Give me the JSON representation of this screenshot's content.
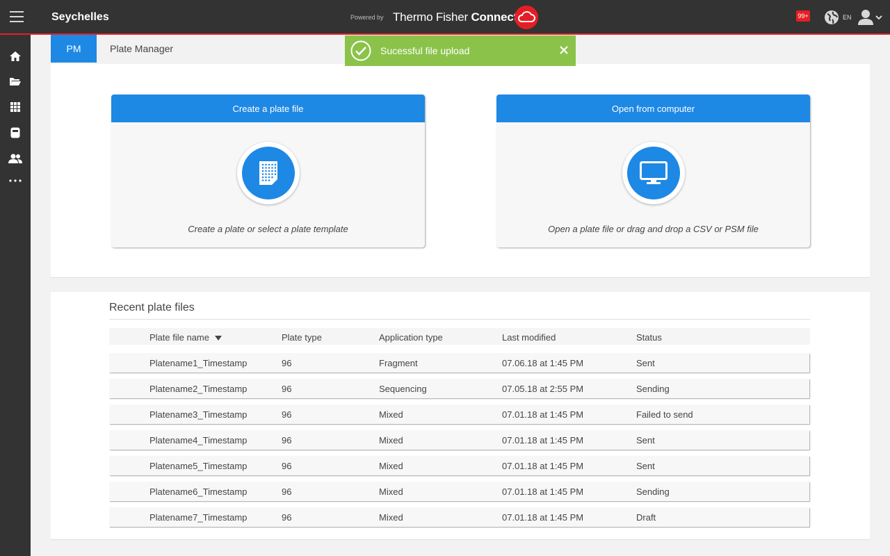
{
  "header": {
    "app_title": "Seychelles",
    "powered_by": "Powered by",
    "brand_light": "Thermo Fisher ",
    "brand_bold": "Connect",
    "notification_count": "99+",
    "language": "EN",
    "bar_color": "#333333",
    "accent_color": "#e51e25"
  },
  "sidebar": {
    "items": [
      {
        "name": "home-icon"
      },
      {
        "name": "folder-icon"
      },
      {
        "name": "apps-grid-icon"
      },
      {
        "name": "storage-icon"
      },
      {
        "name": "users-icon"
      },
      {
        "name": "more-icon"
      }
    ]
  },
  "tabs": {
    "active_badge": "PM",
    "module_label": "Plate Manager"
  },
  "toast": {
    "message": "Sucessful file upload",
    "color": "#8bc34a"
  },
  "actions": {
    "create": {
      "title": "Create a plate file",
      "subtitle": "Create a plate or select a plate template",
      "icon": "plate-grid-icon"
    },
    "open": {
      "title": "Open from computer",
      "subtitle": "Open a plate file or drag and drop a CSV or PSM file",
      "icon": "monitor-icon"
    }
  },
  "recent": {
    "title": "Recent plate files",
    "columns": [
      "Plate file name",
      "Plate type",
      "Application type",
      "Last modified",
      "Status"
    ],
    "rows": [
      {
        "name": "Platename1_Timestamp",
        "plate_type": "96",
        "app_type": "Fragment",
        "modified": "07.06.18 at 1:45 PM",
        "status": "Sent"
      },
      {
        "name": "Platename2_Timestamp",
        "plate_type": "96",
        "app_type": "Sequencing",
        "modified": "07.05.18 at 2:55 PM",
        "status": "Sending"
      },
      {
        "name": "Platename3_Timestamp",
        "plate_type": "96",
        "app_type": "Mixed",
        "modified": "07.01.18 at 1:45 PM",
        "status": "Failed to send"
      },
      {
        "name": "Platename4_Timestamp",
        "plate_type": "96",
        "app_type": "Mixed",
        "modified": "07.01.18 at 1:45 PM",
        "status": "Sent"
      },
      {
        "name": "Platename5_Timestamp",
        "plate_type": "96",
        "app_type": "Mixed",
        "modified": "07.01.18 at 1:45 PM",
        "status": "Sent"
      },
      {
        "name": "Platename6_Timestamp",
        "plate_type": "96",
        "app_type": "Mixed",
        "modified": "07.01.18 at 1:45 PM",
        "status": "Sending"
      },
      {
        "name": "Platename7_Timestamp",
        "plate_type": "96",
        "app_type": "Mixed",
        "modified": "07.01.18 at 1:45 PM",
        "status": "Draft"
      }
    ]
  }
}
